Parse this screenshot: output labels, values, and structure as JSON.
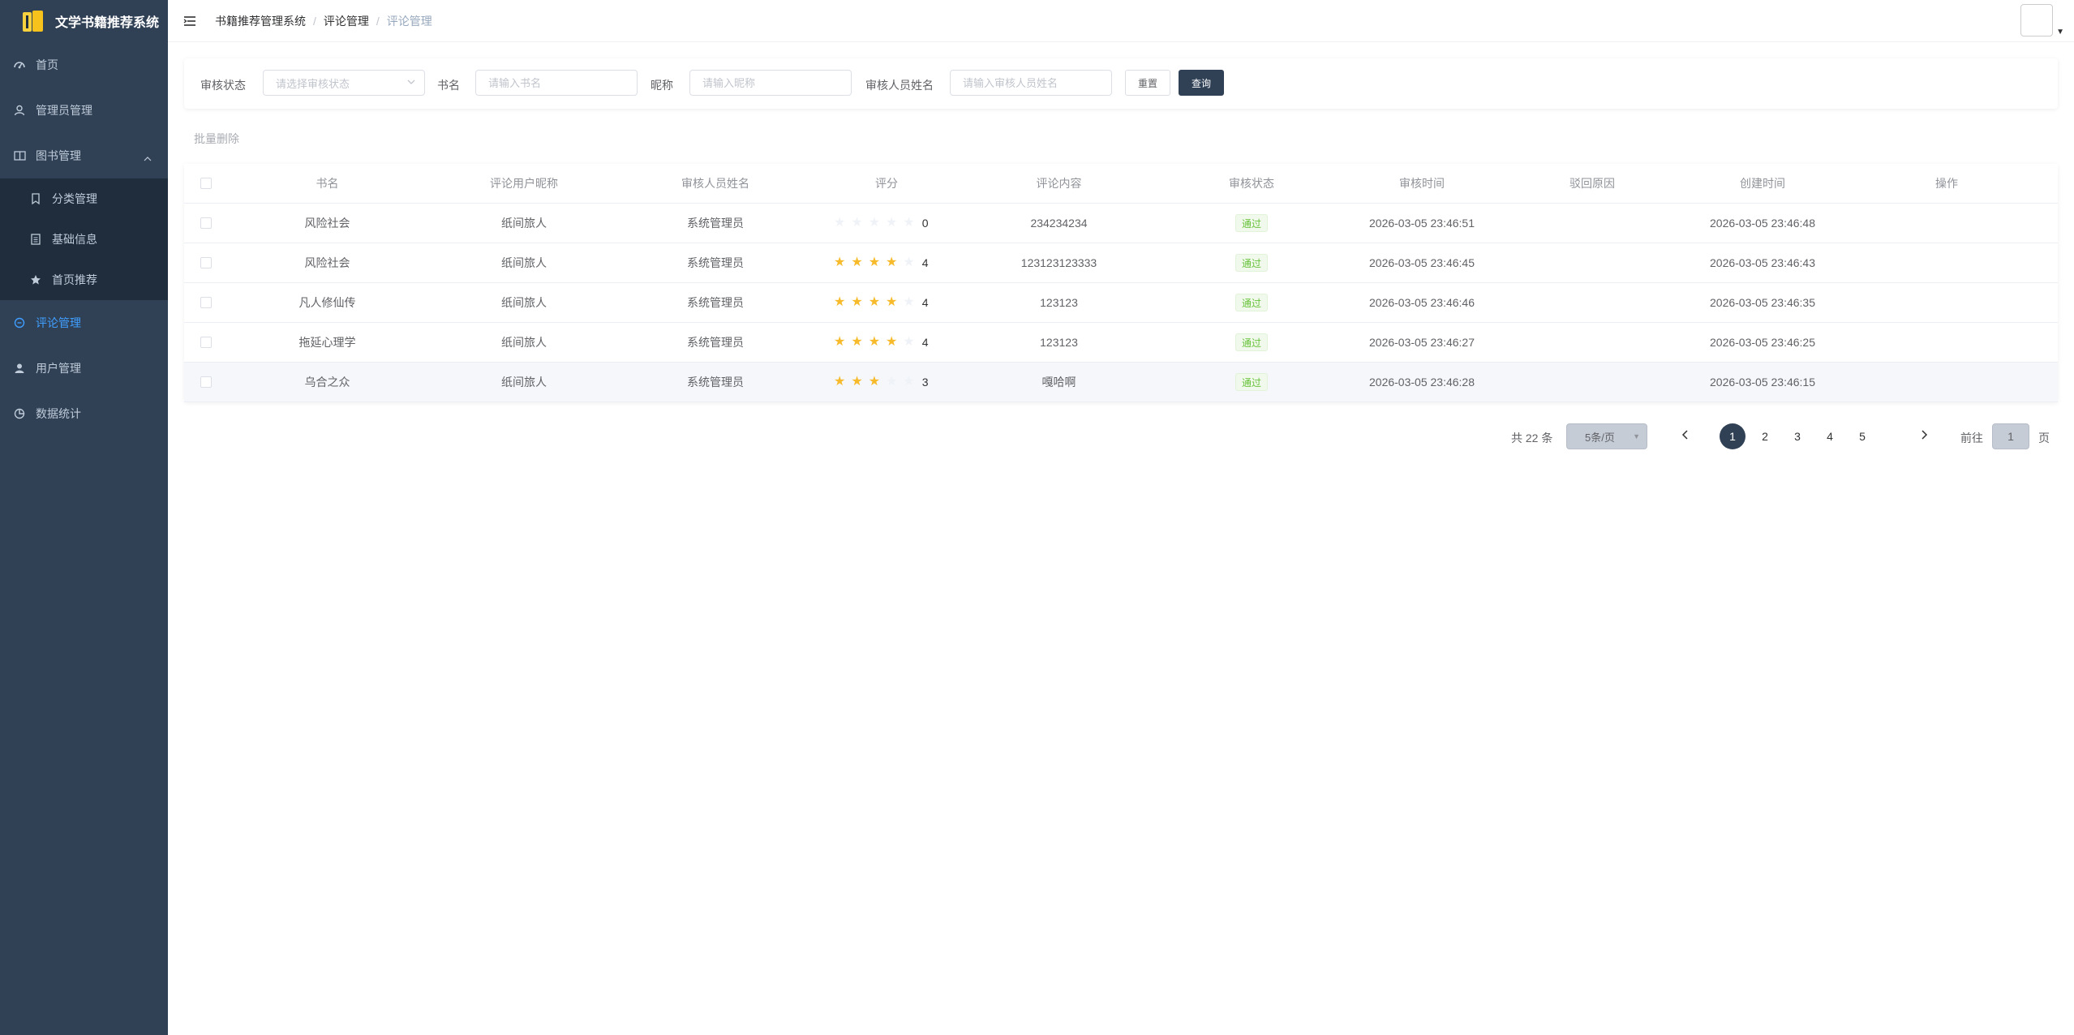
{
  "app": {
    "title": "文学书籍推荐系统"
  },
  "sidebar": {
    "items": [
      {
        "label": "首页",
        "icon": "dashboard-icon"
      },
      {
        "label": "管理员管理",
        "icon": "user-icon"
      },
      {
        "label": "图书管理",
        "icon": "book-icon",
        "expanded": true
      },
      {
        "label": "评论管理",
        "icon": "comment-icon",
        "active": true
      },
      {
        "label": "用户管理",
        "icon": "person-icon"
      },
      {
        "label": "数据统计",
        "icon": "pie-chart-icon"
      }
    ],
    "sub_items": [
      {
        "label": "分类管理",
        "icon": "bookmark-icon"
      },
      {
        "label": "基础信息",
        "icon": "document-icon"
      },
      {
        "label": "首页推荐",
        "icon": "star-icon"
      }
    ]
  },
  "header": {
    "breadcrumb": [
      "书籍推荐管理系统",
      "评论管理",
      "评论管理"
    ],
    "separator": "/"
  },
  "search": {
    "status_label": "审核状态",
    "status_placeholder": "请选择审核状态",
    "book_label": "书名",
    "book_placeholder": "请输入书名",
    "nick_label": "昵称",
    "nick_placeholder": "请输入昵称",
    "auditor_label": "审核人员姓名",
    "auditor_placeholder": "请输入审核人员姓名",
    "reset_label": "重置",
    "query_label": "查询"
  },
  "toolbar": {
    "batch_delete_label": "批量删除"
  },
  "table": {
    "columns": [
      "书名",
      "评论用户昵称",
      "审核人员姓名",
      "评分",
      "评论内容",
      "审核状态",
      "审核时间",
      "驳回原因",
      "创建时间",
      "操作"
    ],
    "rows": [
      {
        "book": "风险社会",
        "nick": "纸间旅人",
        "auditor": "系统管理员",
        "score": 0,
        "score_text": "0",
        "content": "234234234",
        "status": "通过",
        "audit_time": "2026-03-05 23:46:51",
        "reject": "",
        "create_time": "2026-03-05 23:46:48"
      },
      {
        "book": "风险社会",
        "nick": "纸间旅人",
        "auditor": "系统管理员",
        "score": 4,
        "score_text": "4",
        "content": "123123123333",
        "status": "通过",
        "audit_time": "2026-03-05 23:46:45",
        "reject": "",
        "create_time": "2026-03-05 23:46:43"
      },
      {
        "book": "凡人修仙传",
        "nick": "纸间旅人",
        "auditor": "系统管理员",
        "score": 4,
        "score_text": "4",
        "content": "123123",
        "status": "通过",
        "audit_time": "2026-03-05 23:46:46",
        "reject": "",
        "create_time": "2026-03-05 23:46:35"
      },
      {
        "book": "拖延心理学",
        "nick": "纸间旅人",
        "auditor": "系统管理员",
        "score": 4,
        "score_text": "4",
        "content": "123123",
        "status": "通过",
        "audit_time": "2026-03-05 23:46:27",
        "reject": "",
        "create_time": "2026-03-05 23:46:25"
      },
      {
        "book": "乌合之众",
        "nick": "纸间旅人",
        "auditor": "系统管理员",
        "score": 3,
        "score_text": "3",
        "content": "嘎哈啊",
        "status": "通过",
        "audit_time": "2026-03-05 23:46:28",
        "reject": "",
        "create_time": "2026-03-05 23:46:15"
      }
    ]
  },
  "pagination": {
    "total_text": "共 22 条",
    "page_size": "5条/页",
    "pages": [
      "1",
      "2",
      "3",
      "4",
      "5"
    ],
    "current": "1",
    "goto_label": "前往",
    "goto_value": "1",
    "page_suffix": "页"
  },
  "colors": {
    "sidebar_bg": "#304156",
    "submenu_bg": "#1f2d3d",
    "active": "#409eff",
    "star": "#f7ba2a",
    "tag_green": "#67c23a"
  }
}
